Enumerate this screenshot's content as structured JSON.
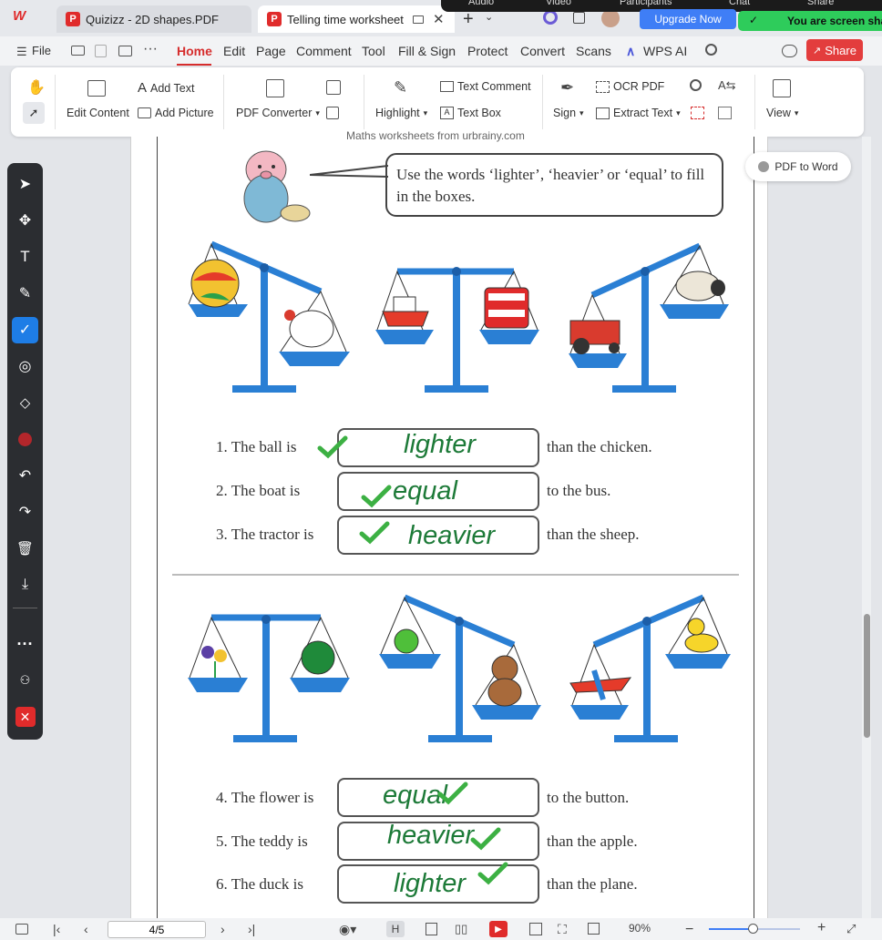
{
  "tabs": [
    {
      "label": "Quizizz - 2D shapes.PDF",
      "active": false
    },
    {
      "label": "Telling time worksheet Ge",
      "active": true
    }
  ],
  "meeting_bar": {
    "items": [
      "Audio",
      "Video",
      "Participants",
      "Chat",
      "Share"
    ]
  },
  "upgrade_label": "Upgrade Now",
  "screen_share_label": "You are screen sha",
  "menu": {
    "file": "File",
    "items": [
      "Home",
      "Edit",
      "Page",
      "Comment",
      "Tool",
      "Fill & Sign",
      "Protect",
      "Convert",
      "Scans"
    ],
    "wps_ai": "WPS AI",
    "share": "Share"
  },
  "ribbon": {
    "edit_content": "Edit Content",
    "add_text": "Add Text",
    "add_picture": "Add Picture",
    "pdf_converter": "PDF Converter",
    "highlight": "Highlight",
    "text_comment": "Text Comment",
    "text_box": "Text Box",
    "sign": "Sign",
    "ocr_pdf": "OCR PDF",
    "extract_text": "Extract Text",
    "view": "View"
  },
  "pdf_to_word": "PDF to Word",
  "worksheet": {
    "header": "Maths worksheets from urbrainy.com",
    "instruction": "Use the words ‘lighter’, ‘heavier’ or ‘equal’ to fill in the boxes.",
    "questions": [
      {
        "prefix": "1. The ball is",
        "answer": "lighter",
        "suffix": "than the chicken."
      },
      {
        "prefix": "2. The boat is",
        "answer": "equal",
        "suffix": "to the bus."
      },
      {
        "prefix": "3. The tractor is",
        "answer": "heavier",
        "suffix": "than the sheep."
      },
      {
        "prefix": "4. The flower is",
        "answer": "equal",
        "suffix": "to the button."
      },
      {
        "prefix": "5. The teddy is",
        "answer": "heavier",
        "suffix": "than the apple."
      },
      {
        "prefix": "6. The duck is",
        "answer": "lighter",
        "suffix": "than the plane."
      }
    ]
  },
  "status": {
    "page": "4/5",
    "zoom": "90%"
  },
  "colors": {
    "accent": "#d62d2d",
    "scale_blue": "#2a7fd4",
    "answer_green": "#1d7a38",
    "tick_green": "#3cb043"
  }
}
